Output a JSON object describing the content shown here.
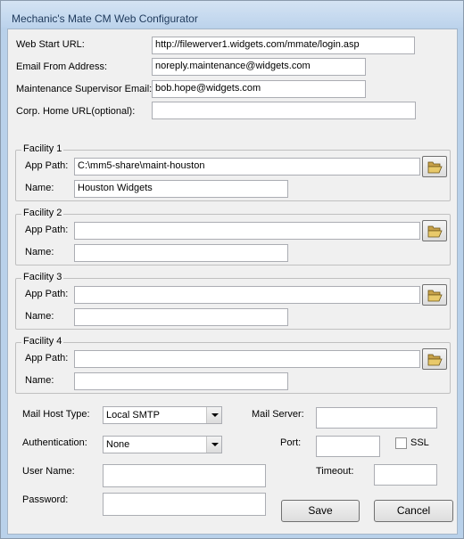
{
  "window": {
    "title": "Mechanic's Mate CM Web Configurator"
  },
  "general": {
    "web_start_url_label": "Web Start URL:",
    "web_start_url_value": "http://filewerver1.widgets.com/mmate/login.asp",
    "email_from_label": "Email From Address:",
    "email_from_value": "noreply.maintenance@widgets.com",
    "supervisor_email_label": "Maintenance Supervisor Email:",
    "supervisor_email_value": "bob.hope@widgets.com",
    "corp_home_label": "Corp. Home URL(optional):",
    "corp_home_value": ""
  },
  "facilities": [
    {
      "title": "Facility 1",
      "app_path_label": "App Path:",
      "app_path_value": "C:\\mm5-share\\maint-houston",
      "name_label": "Name:",
      "name_value": "Houston Widgets"
    },
    {
      "title": "Facility 2",
      "app_path_label": "App Path:",
      "app_path_value": "",
      "name_label": "Name:",
      "name_value": ""
    },
    {
      "title": "Facility 3",
      "app_path_label": "App Path:",
      "app_path_value": "",
      "name_label": "Name:",
      "name_value": ""
    },
    {
      "title": "Facility 4",
      "app_path_label": "App Path:",
      "app_path_value": "",
      "name_label": "Name:",
      "name_value": ""
    }
  ],
  "mail": {
    "host_type_label": "Mail Host Type:",
    "host_type_value": "Local SMTP",
    "server_label": "Mail Server:",
    "server_value": "",
    "auth_label": "Authentication:",
    "auth_value": "None",
    "port_label": "Port:",
    "port_value": "",
    "ssl_label": "SSL",
    "ssl_checked": false,
    "username_label": "User Name:",
    "username_value": "",
    "timeout_label": "Timeout:",
    "timeout_value": "",
    "password_label": "Password:",
    "password_value": ""
  },
  "buttons": {
    "save": "Save",
    "cancel": "Cancel"
  },
  "icons": {
    "browse": "open-folder-icon",
    "dropdown": "chevron-down-icon"
  }
}
